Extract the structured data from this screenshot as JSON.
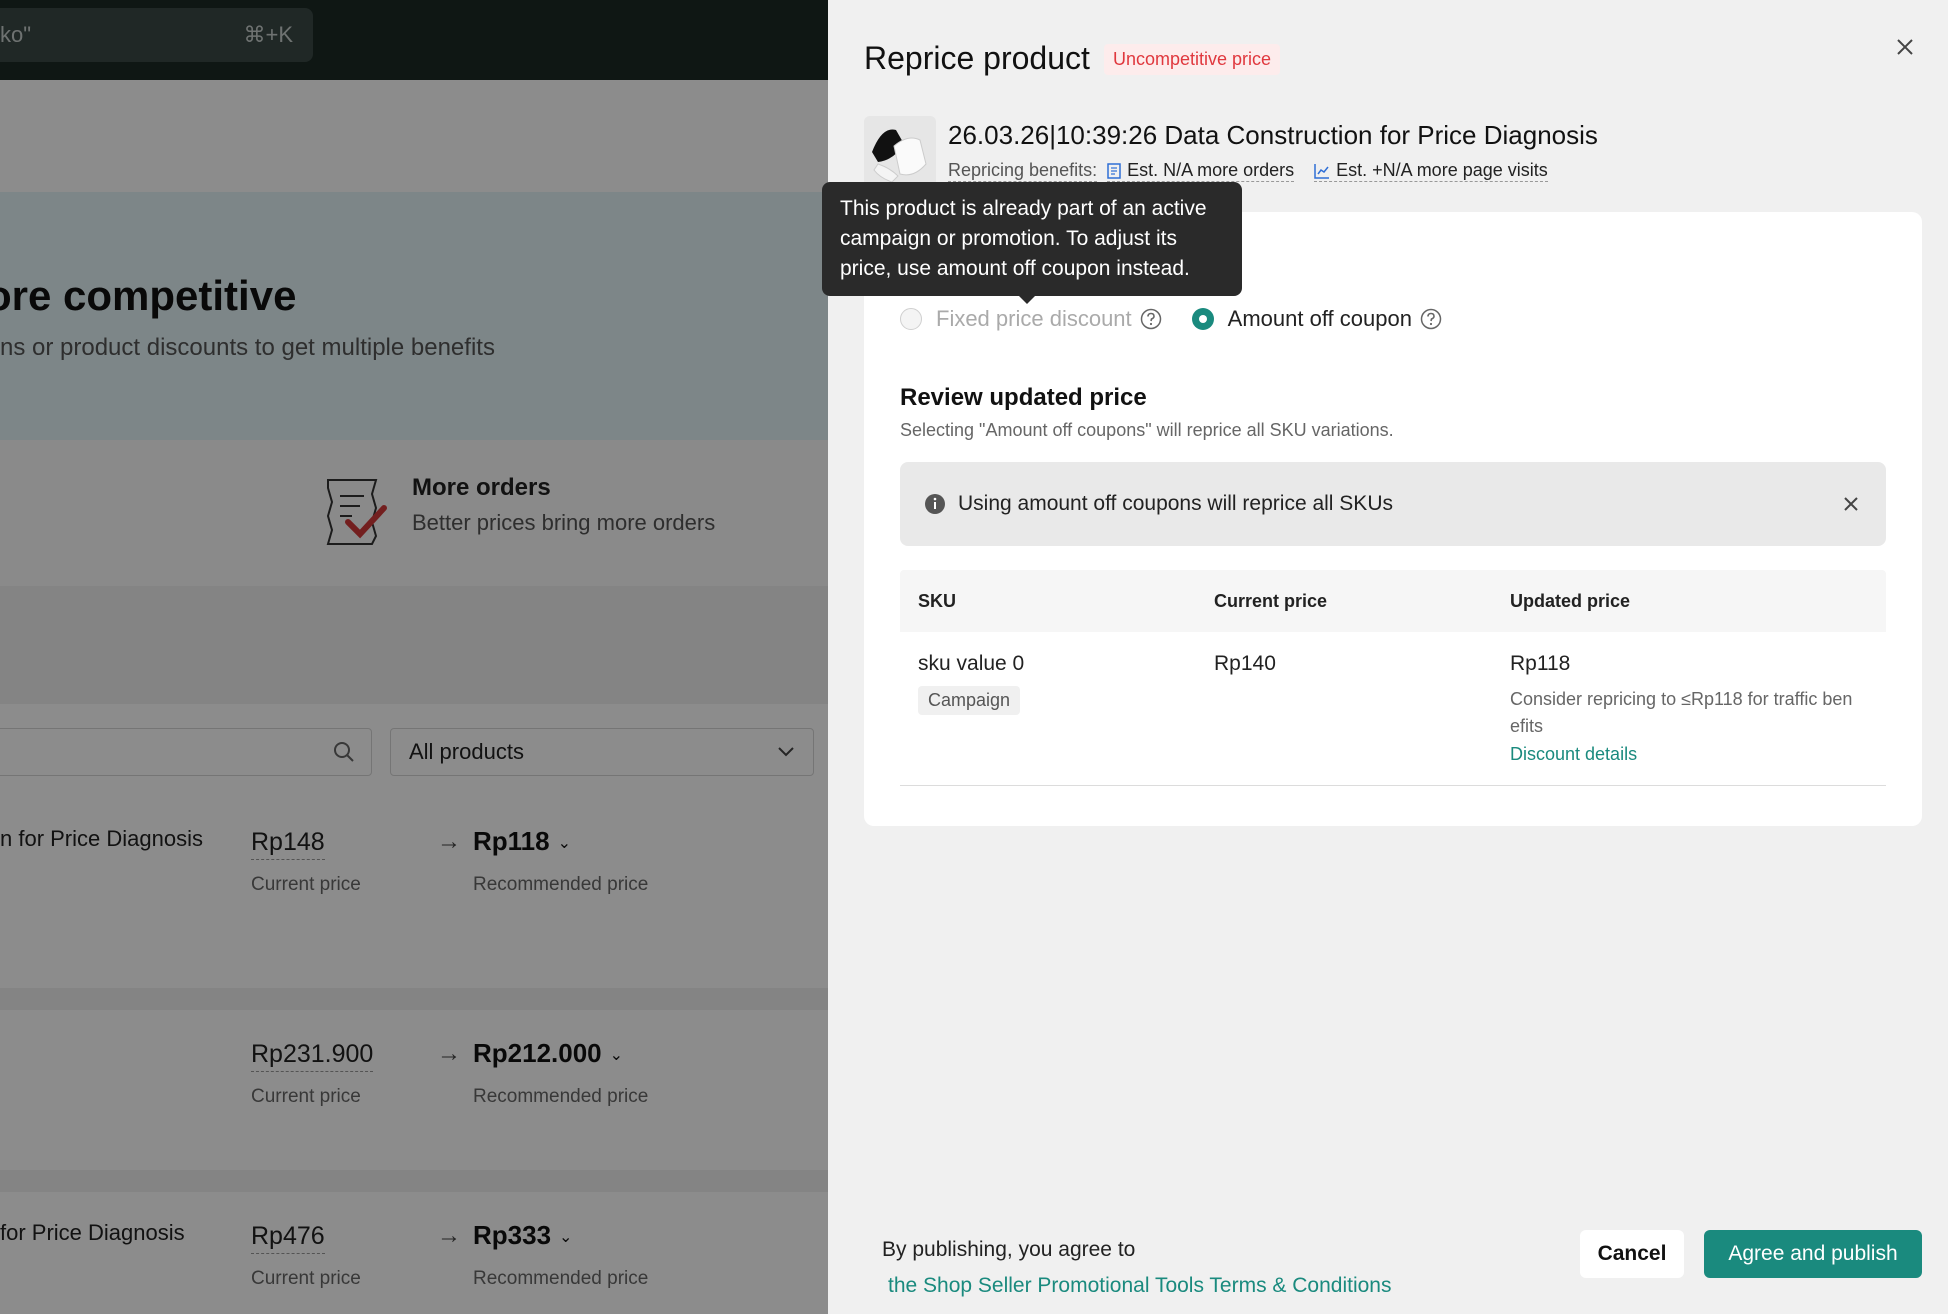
{
  "background": {
    "search": {
      "text": "ko\"",
      "shortcut": "⌘+K"
    },
    "hero": {
      "title": "ore competitive",
      "subtitle": "ns or product discounts to get multiple benefits"
    },
    "benefit": {
      "title": "More orders",
      "subtitle": "Better prices bring more orders"
    },
    "filter": {
      "selected": "All products"
    },
    "rows": [
      {
        "name": "n for Price Diagnosis",
        "current": "Rp148",
        "current_label": "Current price",
        "recommended": "Rp118",
        "recommended_label": "Recommended price"
      },
      {
        "name": "",
        "current": "Rp231.900",
        "current_label": "Current price",
        "recommended": "Rp212.000",
        "recommended_label": "Recommended price"
      },
      {
        "name": " for Price Diagnosis",
        "current": "Rp476",
        "current_label": "Current price",
        "recommended": "Rp333",
        "recommended_label": "Recommended price"
      }
    ]
  },
  "drawer": {
    "title": "Reprice product",
    "status_badge": "Uncompetitive price",
    "product": {
      "name": "26.03.26|10:39:26 Data Construction for Price Diagnosis",
      "benefits_label": "Repricing benefits:",
      "benefit_orders": "Est. N/A more orders",
      "benefit_visits": "Est. +N/A more page visits"
    },
    "tooltip": "This product is already part of an active campaign or promotion. To adjust its price, use amount off coupon instead.",
    "options": {
      "fixed": "Fixed price discount",
      "coupon": "Amount off coupon",
      "selected": "coupon"
    },
    "review": {
      "title": "Review updated price",
      "subtitle": "Selecting \"Amount off coupons\" will reprice all SKU variations.",
      "info": "Using amount off coupons will reprice all SKUs"
    },
    "table": {
      "headers": [
        "SKU",
        "Current price",
        "Updated price"
      ],
      "rows": [
        {
          "sku": "sku value 0",
          "tag": "Campaign",
          "current": "Rp140",
          "updated": "Rp118",
          "hint": "Consider repricing to ≤Rp118 for traffic ben efits",
          "link": "Discount details"
        }
      ]
    },
    "footer": {
      "agree_text": "By publishing, you agree to",
      "terms_link": "the Shop Seller Promotional Tools Terms & Conditions",
      "cancel": "Cancel",
      "publish": "Agree and publish"
    }
  },
  "colors": {
    "accent": "#1a8a7e",
    "badge_text": "#e0383e",
    "badge_bg": "#fdecec",
    "tooltip_bg": "#2a2a2a"
  },
  "icons": [
    "search-icon",
    "chevron-down-icon",
    "arrow-right-icon",
    "receipt-check-icon",
    "close-icon",
    "question-icon",
    "info-icon",
    "document-icon",
    "chart-icon"
  ]
}
